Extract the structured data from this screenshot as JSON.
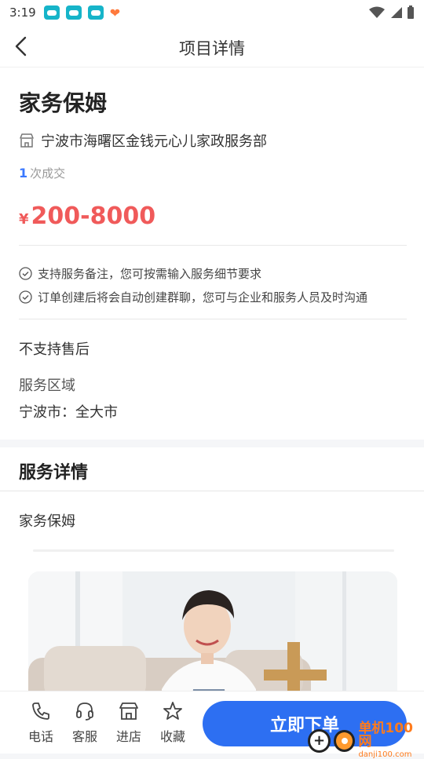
{
  "status_bar": {
    "time": "3:19"
  },
  "nav": {
    "title": "项目详情"
  },
  "product": {
    "title": "家务保姆",
    "shop_name": "宁波市海曙区金钱元心儿家政服务部",
    "deal_count": "1",
    "deal_label": "次成交",
    "currency": "¥",
    "price": "200-8000"
  },
  "features": [
    "支持服务备注，您可按需输入服务细节要求",
    "订单创建后将会自动创建群聊，您可与企业和服务人员及时沟通"
  ],
  "after_sale": "不支持售后",
  "service_area": {
    "label": "服务区域",
    "value": "宁波市：全大市"
  },
  "details": {
    "section_title": "服务详情",
    "text": "家务保姆"
  },
  "bottom_bar": {
    "phone_label": "电话",
    "service_label": "客服",
    "store_label": "进店",
    "favorite_label": "收藏",
    "order_label": "立即下单"
  },
  "watermark": {
    "cn": "单机100网",
    "en": "danji100.com"
  },
  "colors": {
    "accent": "#2d6ff2",
    "price": "#f05a5a",
    "muted": "#999999"
  }
}
